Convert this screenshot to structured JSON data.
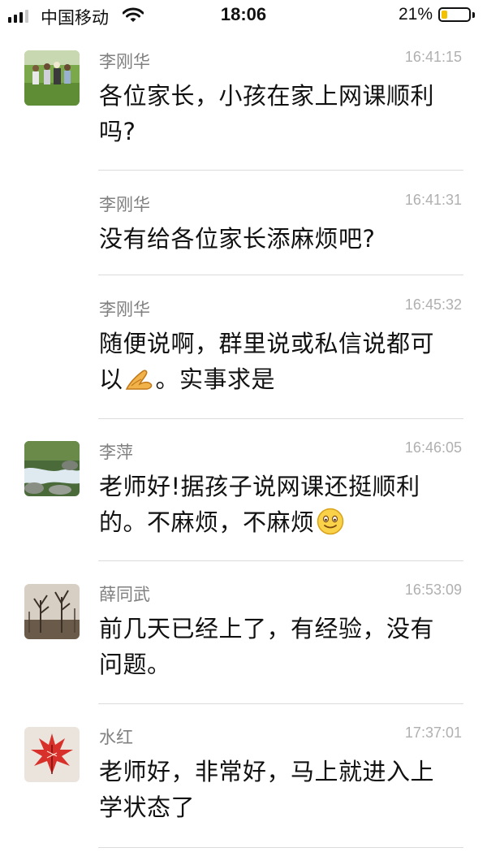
{
  "status_bar": {
    "carrier": "中国移动",
    "time": "18:06",
    "battery_percent": "21%",
    "battery_level": 0.21,
    "signal_bars_filled": 3,
    "signal_bars_total": 4
  },
  "messages": [
    {
      "sender": "李刚华",
      "time": "16:41:15",
      "text": "各位家长，小孩在家上网课顺利吗?",
      "avatar": "farm-field-avatar"
    },
    {
      "sender": "李刚华",
      "time": "16:41:31",
      "text": "没有给各位家长添麻烦吧?"
    },
    {
      "sender": "李刚华",
      "time": "16:45:32",
      "text_before": "随便说啊，群里说或私信说都可以",
      "emoji": "ok-hand-emoji",
      "text_after": "。实事求是"
    },
    {
      "sender": "李萍",
      "time": "16:46:05",
      "text": "老师好!据孩子说网课还挺顺利的。不麻烦，不麻烦",
      "emoji": "smiley-face-emoji",
      "avatar": "stream-avatar"
    },
    {
      "sender": "薛同武",
      "time": "16:53:09",
      "text": "前几天已经上了，有经验，没有问题。",
      "avatar": "bare-trees-avatar"
    },
    {
      "sender": "水红",
      "time": "17:37:01",
      "text": "老师好，非常好，马上就进入上学状态了",
      "avatar": "red-leaf-avatar"
    }
  ],
  "colors": {
    "sender": "#808080",
    "timestamp": "#b0b0b0",
    "divider": "#dcdcdc",
    "battery_fill": "#f2c200"
  }
}
